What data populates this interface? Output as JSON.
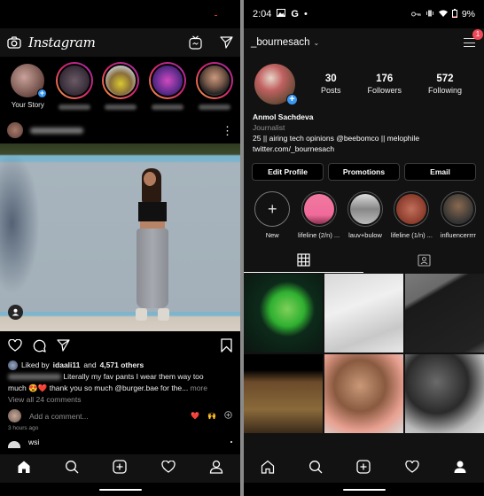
{
  "left": {
    "app_title": "Instagram",
    "stories": [
      {
        "label": "Your Story",
        "own": true
      },
      {
        "label": "",
        "own": false
      },
      {
        "label": "",
        "own": false
      },
      {
        "label": "",
        "own": false
      },
      {
        "label": "",
        "own": false
      }
    ],
    "post": {
      "liked_by_prefix": "Liked by",
      "liked_by_user": "idaali11",
      "liked_by_and": "and",
      "liked_by_others": "4,571 others",
      "caption_line1": "Literally my fav pants I wear them way too",
      "caption_line2_start": "much",
      "caption_emojis": "😍❤️",
      "caption_line2_end": "thank you so much @burger.bae for the...",
      "more_label": "more",
      "view_comments": "View all 24 comments",
      "comment_placeholder": "Add a comment...",
      "quick_reactions": [
        "❤️",
        "🙌"
      ],
      "timestamp": "3 hours ago"
    },
    "next_post_user": "wsi"
  },
  "right": {
    "status": {
      "time": "2:04",
      "battery": "9%"
    },
    "username": "_bournesach",
    "notification_count": "1",
    "stats": [
      {
        "value": "30",
        "label": "Posts"
      },
      {
        "value": "176",
        "label": "Followers"
      },
      {
        "value": "572",
        "label": "Following"
      }
    ],
    "bio": {
      "name": "Anmol Sachdeva",
      "category": "Journalist",
      "text": "25 || airing tech opinions @beebomco || melophile",
      "link": "twitter.com/_bournesach"
    },
    "buttons": {
      "edit_profile": "Edit Profile",
      "promotions": "Promotions",
      "email": "Email"
    },
    "highlights": [
      {
        "label": "New"
      },
      {
        "label": "lifeline (2/n) ..."
      },
      {
        "label": "lauv+bulow"
      },
      {
        "label": "lifeline (1/n) ..."
      },
      {
        "label": "influencerrrr"
      }
    ],
    "colors": {
      "accent_blue": "#3897f0",
      "notification_red": "#ed4956",
      "like_red": "#ed4956"
    }
  }
}
